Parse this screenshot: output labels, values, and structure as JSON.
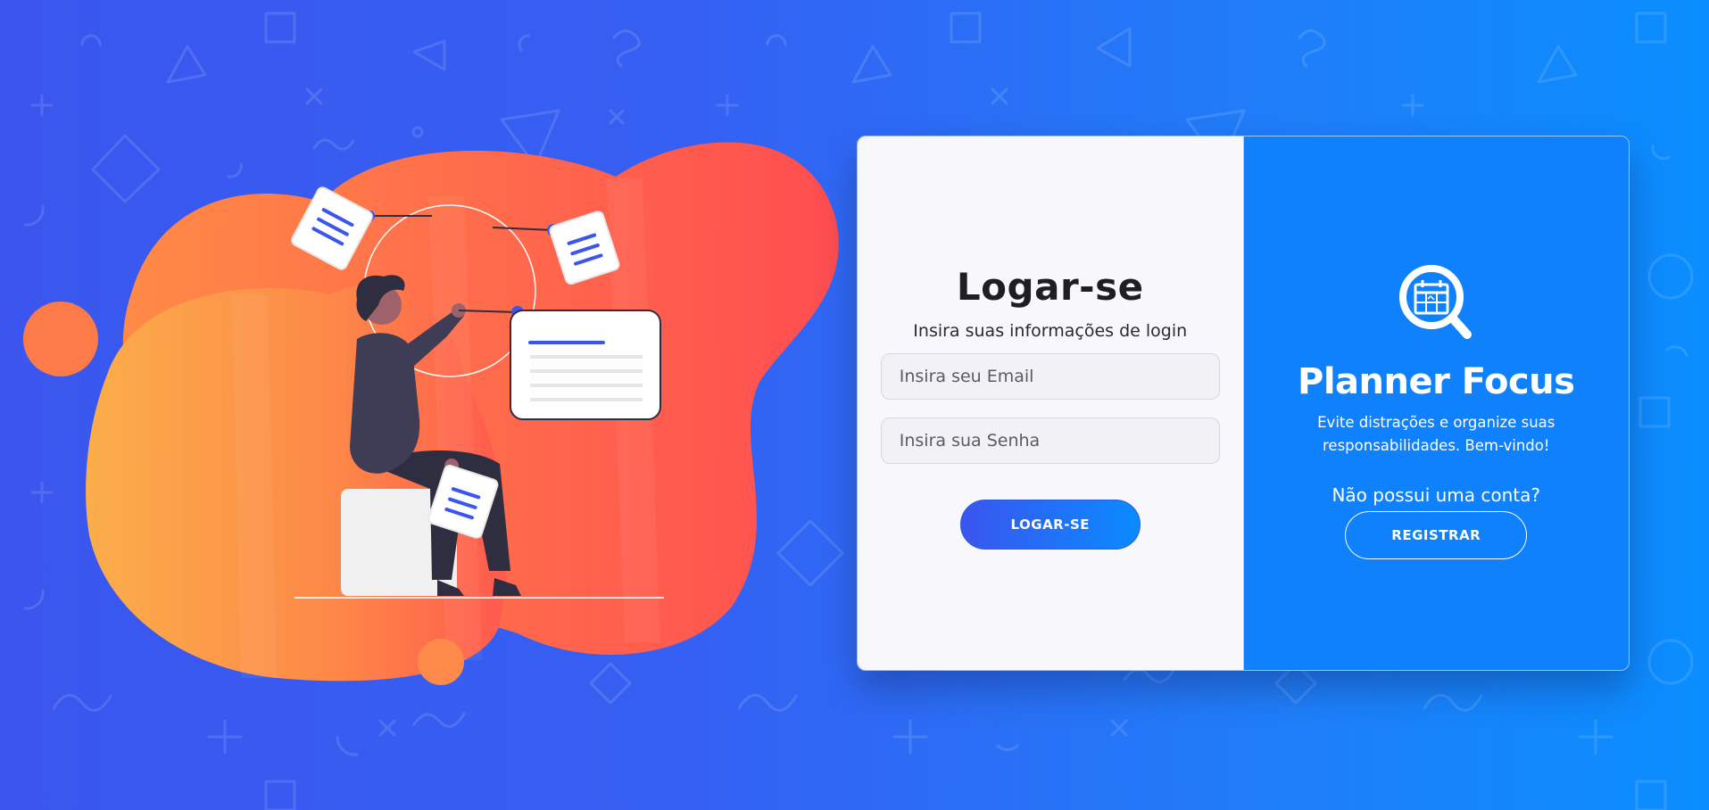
{
  "login": {
    "title": "Logar-se",
    "subtitle": "Insira suas informações de login",
    "email_placeholder": "Insira seu Email",
    "password_placeholder": "Insira sua Senha",
    "submit_label": "LOGAR-SE"
  },
  "brand": {
    "logo_icon": "calendar-search-icon",
    "name": "Planner Focus",
    "tagline": "Evite distrações e organize suas responsabilidades. Bem-vindo!",
    "no_account_text": "Não possui uma conta?",
    "register_label": "REGISTRAR"
  },
  "colors": {
    "background_start": "#3a56ee",
    "background_end": "#0a8eff",
    "brand_panel": "#1081fc",
    "login_panel": "#f8f7fc",
    "blob_orange": "#fba74a",
    "blob_red": "#ff5050"
  }
}
